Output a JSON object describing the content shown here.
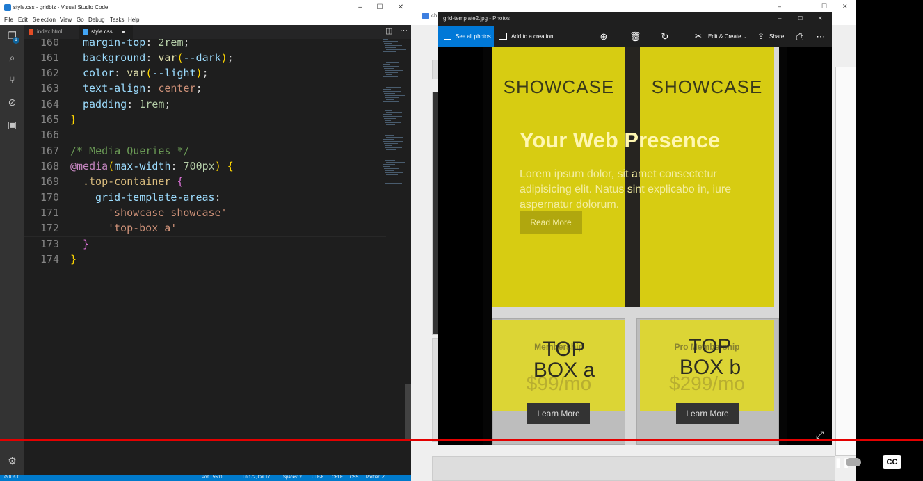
{
  "vscode": {
    "title": "style.css - gridbiz - Visual Studio Code",
    "window_controls": [
      "–",
      "☐",
      "✕"
    ],
    "menu": [
      "File",
      "Edit",
      "Selection",
      "View",
      "Go",
      "Debug",
      "Tasks",
      "Help"
    ],
    "activity_badge": "1",
    "tabs": [
      {
        "label": "index.html",
        "icon": "html-file-icon"
      },
      {
        "label": "style.css",
        "icon": "css-file-icon",
        "active": true,
        "modified_dot": "●"
      }
    ],
    "line_numbers": [
      "160",
      "161",
      "162",
      "163",
      "164",
      "165",
      "166",
      "167",
      "168",
      "169",
      "170",
      "171",
      "172",
      "173",
      "174"
    ],
    "status": {
      "errors": "⊘ 0  ⚠ 0",
      "port": "Port : 5500",
      "position": "Ln 172, Col 17",
      "spaces": "Spaces: 2",
      "encoding": "UTF-8",
      "eol": "CRLF",
      "lang": "CSS",
      "prettier": "Prettier: ✓"
    }
  },
  "photos": {
    "title": "grid-template2.jpg - Photos",
    "see_all": "See all photos",
    "add_creation": "Add to a creation",
    "edit_create": "Edit & Create",
    "share": "Share",
    "image": {
      "showcase_left": "SHOWCASE",
      "showcase_right": "SHOWCASE",
      "hero_heading": "Your Web Presence",
      "hero_text": "Lorem ipsum dolor, sit amet consectetur adipisicing elit. Natus sint explicabo in, iure aspernatur dolorum.",
      "read_more": "Read More",
      "box_a": {
        "overlay": "TOP BOX a",
        "title": "Membership",
        "price": "$99/mo",
        "button": "Learn More"
      },
      "box_b": {
        "overlay": "TOP BOX b",
        "title": "Pro Membership",
        "price": "$299/mo",
        "button": "Learn More"
      }
    }
  },
  "browser": {
    "tab_label": "ch"
  },
  "video": {
    "cc": "CC"
  },
  "colors": {
    "accent": "#007acc",
    "photos_blue": "#0078d7",
    "progress": "#e40000",
    "highlight": "#d7cc12"
  }
}
